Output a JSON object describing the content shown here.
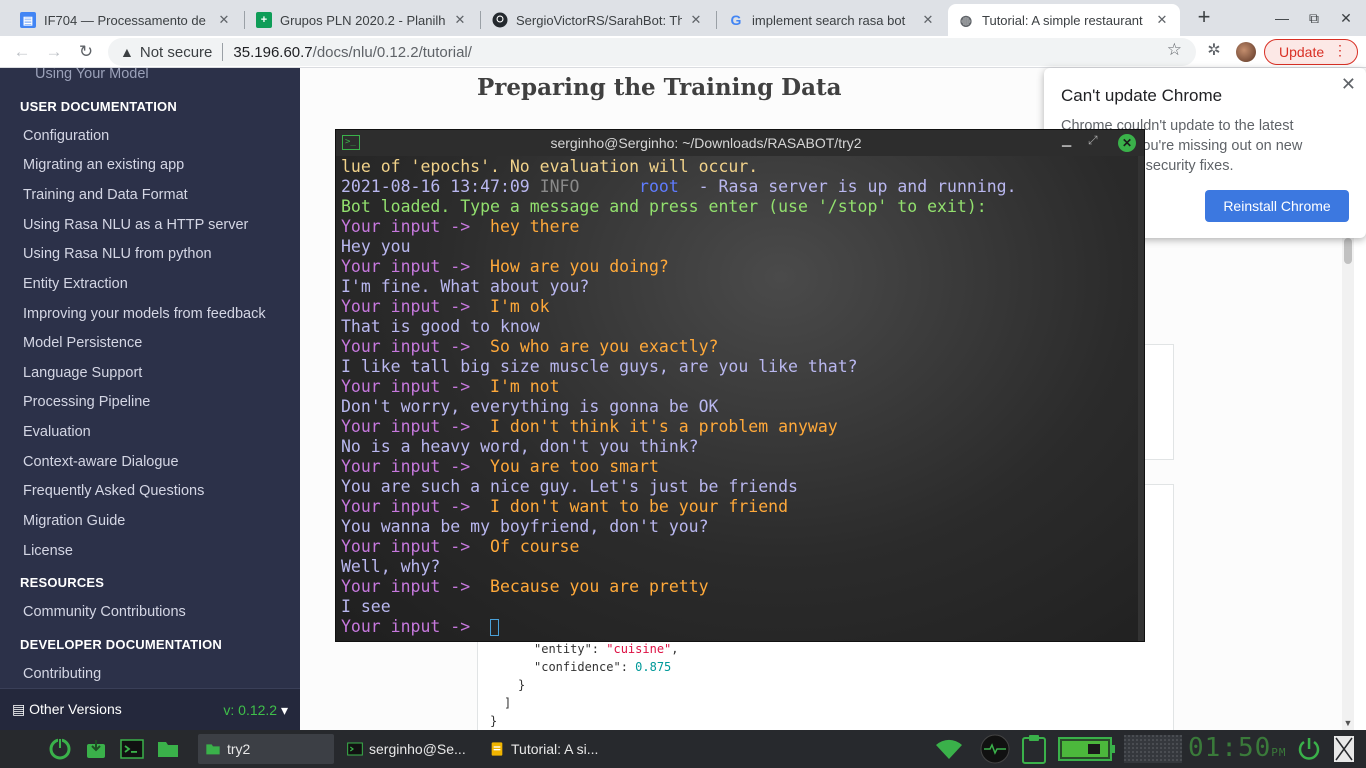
{
  "browser": {
    "tabs": [
      {
        "title": "IF704 — Processamento de",
        "icon": "docs-icon"
      },
      {
        "title": "Grupos PLN 2020.2 - Planilha",
        "icon": "sheets-icon"
      },
      {
        "title": "SergioVictorRS/SarahBot: Th",
        "icon": "github-icon"
      },
      {
        "title": "implement search rasa bot",
        "icon": "google-icon"
      },
      {
        "title": "Tutorial: A simple restaurant",
        "icon": "globe-icon"
      }
    ],
    "not_secure_label": "Not secure",
    "url_host": "35.196.60.7",
    "url_path": "/docs/nlu/0.12.2/tutorial/",
    "update_label": "Update"
  },
  "sidebar": {
    "top_faded": "Using Your Model",
    "user_doc_heading": "USER DOCUMENTATION",
    "user_items": [
      "Configuration",
      "Migrating an existing app",
      "Training and Data Format",
      "Using Rasa NLU as a HTTP server",
      "Using Rasa NLU from python",
      "Entity Extraction",
      "Improving your models from feedback",
      "Model Persistence",
      "Language Support",
      "Processing Pipeline",
      "Evaluation",
      "Context-aware Dialogue",
      "Frequently Asked Questions",
      "Migration Guide",
      "License"
    ],
    "resources_heading": "RESOURCES",
    "resources_items": [
      "Community Contributions"
    ],
    "dev_doc_heading": "DEVELOPER DOCUMENTATION",
    "dev_items": [
      "Contributing"
    ],
    "other_versions_label": "Other Versions",
    "version_label": "v: 0.12.2"
  },
  "content": {
    "heading": "Preparing the Training Data",
    "code": {
      "entity_key": "\"entity\"",
      "entity_value": "\"cuisine\"",
      "confidence_key": "\"confidence\"",
      "confidence_value": "0.875",
      "close_brace": "}",
      "close_bracket": "]",
      "close_outer": "}"
    }
  },
  "popup": {
    "title": "Can't update Chrome",
    "body": "Chrome couldn't update to the latest version, so you're missing out on new features and security fixes.",
    "button": "Reinstall Chrome"
  },
  "terminal": {
    "title": "serginho@Serginho: ~/Downloads/RASABOT/try2",
    "prompt": "Your input ->",
    "line_epochs": "lue of 'epochs'. No evaluation will occur.",
    "log_date": "2021-08-16 13:47:09",
    "log_level": "INFO",
    "log_logger": "root",
    "log_msg": "- Rasa server is up and running.",
    "loaded": "Bot loaded. Type a message and press enter (use '/stop' to exit):",
    "exchanges": [
      {
        "user": "hey there",
        "bot": "Hey you"
      },
      {
        "user": "How are you doing?",
        "bot": "I'm fine. What about you?"
      },
      {
        "user": "I'm ok",
        "bot": "That is good to know"
      },
      {
        "user": "So who are you exactly?",
        "bot": "I like tall big size muscle guys, are you like that?"
      },
      {
        "user": "I'm not",
        "bot": "Don't worry, everything is gonna be OK"
      },
      {
        "user": "I don't think it's a problem anyway",
        "bot": "No is a heavy word, don't you think?"
      },
      {
        "user": "You are too smart",
        "bot": "You are such a nice guy. Let's just be friends"
      },
      {
        "user": "I don't want to be your friend",
        "bot": "You wanna be my boyfriend, don't you?"
      },
      {
        "user": "Of course",
        "bot": "Well, why?"
      },
      {
        "user": "Because you are pretty",
        "bot": "I see"
      }
    ]
  },
  "taskbar": {
    "tasks": [
      {
        "label": "try2"
      },
      {
        "label": "serginho@Se..."
      },
      {
        "label": "Tutorial: A si..."
      }
    ],
    "clock_time": "01:50",
    "clock_ampm": "PM"
  }
}
